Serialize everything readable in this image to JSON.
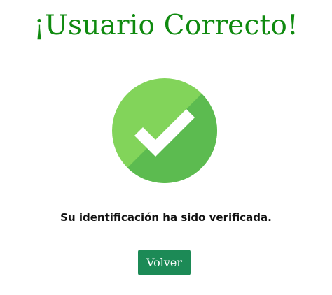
{
  "header": {
    "title": "¡Usuario Correcto!"
  },
  "status": {
    "icon": "check-circle-icon",
    "colors": {
      "light_green": "#82d45a",
      "dark_green": "#5cbb50",
      "check": "#ffffff"
    },
    "message": "Su identificación ha sido verificada."
  },
  "actions": {
    "back_label": "Volver",
    "button_color": "#1c8a56"
  }
}
